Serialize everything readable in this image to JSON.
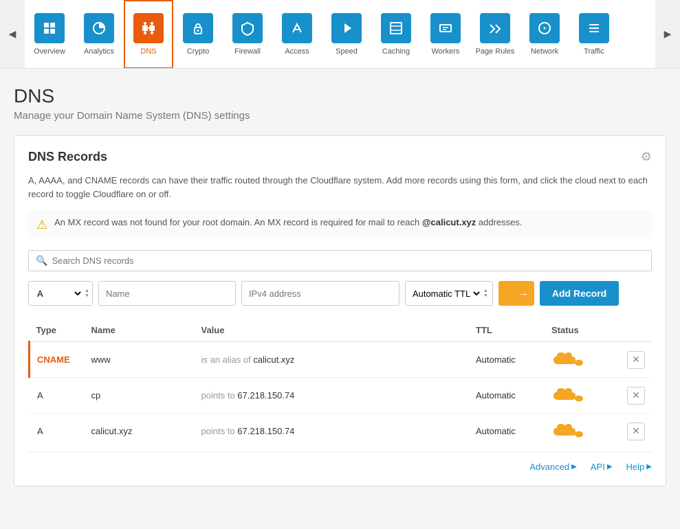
{
  "nav": {
    "left_arrow": "◀",
    "right_arrow": "▶",
    "items": [
      {
        "id": "overview",
        "label": "Overview",
        "icon": "≡",
        "active": false
      },
      {
        "id": "analytics",
        "label": "Analytics",
        "icon": "◎",
        "active": false
      },
      {
        "id": "dns",
        "label": "DNS",
        "icon": "⊞",
        "active": true
      },
      {
        "id": "crypto",
        "label": "Crypto",
        "icon": "🔒",
        "active": false
      },
      {
        "id": "firewall",
        "label": "Firewall",
        "icon": "⛨",
        "active": false
      },
      {
        "id": "access",
        "label": "Access",
        "icon": "⬆",
        "active": false
      },
      {
        "id": "speed",
        "label": "Speed",
        "icon": "⚡",
        "active": false
      },
      {
        "id": "caching",
        "label": "Caching",
        "icon": "▣",
        "active": false
      },
      {
        "id": "workers",
        "label": "Workers",
        "icon": "⌨",
        "active": false
      },
      {
        "id": "pagerules",
        "label": "Page Rules",
        "icon": "▽",
        "active": false
      },
      {
        "id": "network",
        "label": "Network",
        "icon": "◉",
        "active": false
      },
      {
        "id": "traffic",
        "label": "Traffic",
        "icon": "≡",
        "active": false
      }
    ]
  },
  "page": {
    "title": "DNS",
    "subtitle": "Manage your Domain Name System (DNS) settings"
  },
  "card": {
    "title": "DNS Records",
    "description": "A, AAAA, and CNAME records can have their traffic routed through the Cloudflare system. Add more records using this form, and click the cloud next to each record to toggle Cloudflare on or off.",
    "warning": {
      "text_before": "An MX record was not found for your root domain. An MX record is required for mail to reach ",
      "domain": "@calicut.xyz",
      "text_after": " addresses."
    },
    "search_placeholder": "Search DNS records",
    "form": {
      "type_value": "A",
      "name_placeholder": "Name",
      "value_placeholder": "IPv4 address",
      "ttl_label": "Automatic TTL",
      "add_button": "Add Record"
    },
    "table": {
      "headers": [
        "Type",
        "Name",
        "Value",
        "TTL",
        "Status"
      ],
      "rows": [
        {
          "type": "CNAME",
          "type_style": "cname",
          "name": "www",
          "value_pre": "is an alias of",
          "value_main": "calicut.xyz",
          "ttl": "Automatic",
          "has_left_border": true
        },
        {
          "type": "A",
          "type_style": "a",
          "name": "cp",
          "value_pre": "points to",
          "value_main": "67.218.150.74",
          "ttl": "Automatic",
          "has_left_border": false
        },
        {
          "type": "A",
          "type_style": "a",
          "name": "calicut.xyz",
          "value_pre": "points to",
          "value_main": "67.218.150.74",
          "ttl": "Automatic",
          "has_left_border": false
        }
      ]
    },
    "footer": {
      "advanced_label": "Advanced",
      "api_label": "API",
      "help_label": "Help"
    }
  }
}
